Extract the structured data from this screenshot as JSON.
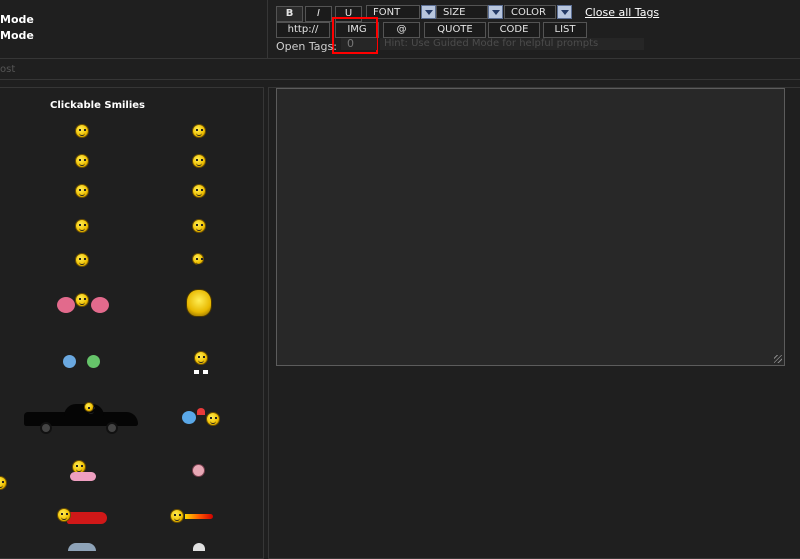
{
  "modes": [
    "Mode",
    "Mode"
  ],
  "toolbar": {
    "bold": "B",
    "italic": "I",
    "underline": "U",
    "font_select": "FONT",
    "size_select": "SIZE",
    "color_select": "COLOR",
    "close_all_tags": "Close all Tags",
    "http": "http://",
    "img": "IMG",
    "at": "@",
    "quote": "QUOTE",
    "code": "CODE",
    "list": "LIST"
  },
  "open_tags": {
    "label": "Open Tags:",
    "value": "0"
  },
  "hint": "Hint: Use Guided Mode for helpful prompts",
  "left_fragment": "ost",
  "smilies": {
    "title": "Clickable Smilies",
    "items": [
      "surprised-smiley-icon",
      "smile-smiley-icon",
      "grin-smiley-icon",
      "laugh-smiley-icon",
      "wink-smiley-icon",
      "happy-smiley-icon",
      "angry-smiley-icon",
      "sad-smiley-icon",
      "rolling-eyes-smiley-icon",
      "sunglasses-smiley-icon",
      "cheerleader-smiley-icon",
      "vampire-smiley-icon",
      "pacman-smiley-icon",
      "dancing-smiley-icon",
      "car-smiley-icon",
      "love-smiley-icon",
      "sleeping-smiley-icon",
      "skull-smiley-icon",
      "superhero-smiley-icon",
      "rocket-smiley-icon"
    ]
  },
  "colors": {
    "background": "#1f1f1f",
    "textarea": "#282828",
    "highlight": "#ff0000",
    "dropdown_arrow": "#b8c6de"
  }
}
